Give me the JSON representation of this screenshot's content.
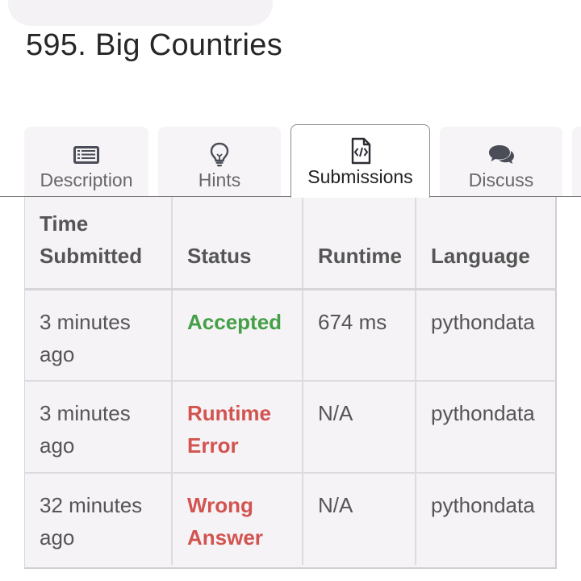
{
  "page": {
    "title": "595. Big Countries"
  },
  "tabs": [
    {
      "label": "Description",
      "icon": "list-icon",
      "active": false
    },
    {
      "label": "Hints",
      "icon": "lightbulb-icon",
      "active": false
    },
    {
      "label": "Submissions",
      "icon": "code-file-icon",
      "active": true
    },
    {
      "label": "Discuss",
      "icon": "chat-bubbles-icon",
      "active": false
    }
  ],
  "submissions": {
    "headers": {
      "time": "Time Submitted",
      "status": "Status",
      "runtime": "Runtime",
      "language": "Language"
    },
    "rows": [
      {
        "time": "3 minutes ago",
        "status": "Accepted",
        "status_type": "accepted",
        "runtime": "674 ms",
        "language": "pythondata"
      },
      {
        "time": "3 minutes ago",
        "status": "Runtime Error",
        "status_type": "error",
        "runtime": "N/A",
        "language": "pythondata"
      },
      {
        "time": "32 minutes ago",
        "status": "Wrong Answer",
        "status_type": "error",
        "runtime": "N/A",
        "language": "pythondata"
      }
    ]
  },
  "colors": {
    "accepted": "#43a047",
    "error": "#d2534f",
    "text": "#555555",
    "title": "#262626"
  }
}
